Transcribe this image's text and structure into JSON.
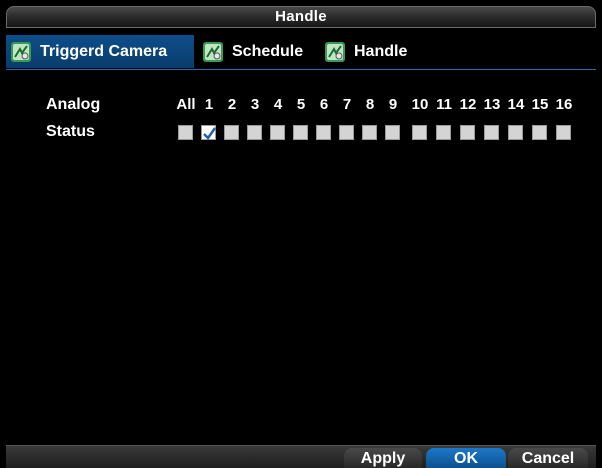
{
  "window": {
    "title": "Handle"
  },
  "tabs": [
    {
      "label": "Triggerd Camera",
      "active": true,
      "icon": "config-icon"
    },
    {
      "label": "Schedule",
      "active": false,
      "icon": "config-icon"
    },
    {
      "label": "Handle",
      "active": false,
      "icon": "config-icon"
    }
  ],
  "camera_table": {
    "row_labels": {
      "analog": "Analog",
      "status": "Status"
    },
    "columns": [
      "All",
      "1",
      "2",
      "3",
      "4",
      "5",
      "6",
      "7",
      "8",
      "9",
      "10",
      "11",
      "12",
      "13",
      "14",
      "15",
      "16"
    ],
    "checked": [
      false,
      true,
      false,
      false,
      false,
      false,
      false,
      false,
      false,
      false,
      false,
      false,
      false,
      false,
      false,
      false,
      false
    ]
  },
  "buttons": {
    "apply": "Apply",
    "ok": "OK",
    "cancel": "Cancel"
  },
  "colors": {
    "accent": "#0d4e8a",
    "tab_border": "#1a6fb4"
  }
}
